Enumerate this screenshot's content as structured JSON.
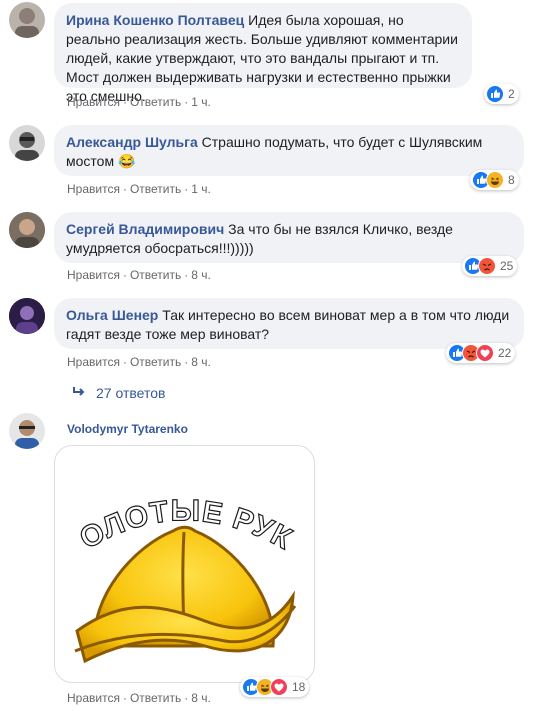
{
  "actions": {
    "like": "Нравится",
    "reply": "Ответить",
    "dot": "·"
  },
  "comments": [
    {
      "author": "Ирина Кошенко Полтавец",
      "text": "Идея была хорошая, но реально реализация жесть. Больше удивляют комментарии людей, какие утверждают, что это вандалы прыгают и тп. Мост должен выдерживать нагрузки и естественно прыжки это смешно.",
      "time": "1 ч.",
      "reaction_count": "2",
      "reactions": [
        "like"
      ]
    },
    {
      "author": "Александр Шульга",
      "text": "Страшно подумать, что будет с Шулявским мостом",
      "emoji": "😂",
      "time": "1 ч.",
      "reaction_count": "8",
      "reactions": [
        "like",
        "haha"
      ]
    },
    {
      "author": "Сергей Владимирович",
      "text": "За что бы не взялся Кличко, везде умудряется обосраться!!!)))))",
      "time": "8 ч.",
      "reaction_count": "25",
      "reactions": [
        "like",
        "angry"
      ]
    },
    {
      "author": "Ольга Шенер",
      "text": "Так интересно во всем виноват мер а в том что люди гадят везде тоже мер виноват?",
      "time": "8 ч.",
      "reaction_count": "22",
      "reactions": [
        "like",
        "angry",
        "love"
      ]
    }
  ],
  "replies_label": "27 ответов",
  "sticker_comment": {
    "author": "Volodymyr Tytarenko",
    "sticker_text": "ЗОЛОТЫЕ РУКИ",
    "time": "8 ч.",
    "reaction_count": "18",
    "reactions": [
      "like",
      "haha",
      "love"
    ]
  },
  "colors": {
    "author": "#385898",
    "meta": "#65676b",
    "bubble": "#f0f2f5",
    "like": "#1877f2",
    "angry": "#f0553a",
    "love": "#f33e58",
    "haha": "#f7b125"
  }
}
